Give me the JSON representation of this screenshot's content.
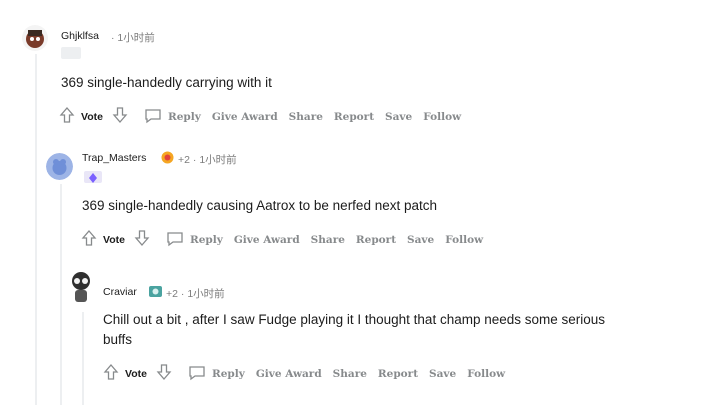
{
  "comments": [
    {
      "username": "Ghjklfsa",
      "meta": "· 1小时前",
      "awards_count": "",
      "body": "369 single-handedly carrying with it",
      "actions": {
        "vote": "Vote",
        "reply": "Reply",
        "give_award": "Give Award",
        "share": "Share",
        "report": "Report",
        "save": "Save",
        "follow": "Follow"
      }
    },
    {
      "username": "Trap_Masters",
      "meta": "· 1小时前",
      "awards_count": "+2",
      "body": "369 single-handedly causing Aatrox to be nerfed next patch",
      "actions": {
        "vote": "Vote",
        "reply": "Reply",
        "give_award": "Give Award",
        "share": "Share",
        "report": "Report",
        "save": "Save",
        "follow": "Follow"
      }
    },
    {
      "username": "Craviar",
      "meta": "· 1小时前",
      "awards_count": "+2",
      "body_line1": "Chill out a bit , after I saw Fudge playing it I thought that champ needs some serious",
      "body_line2": "buffs",
      "actions": {
        "vote": "Vote",
        "reply": "Reply",
        "give_award": "Give Award",
        "share": "Share",
        "report": "Report",
        "save": "Save",
        "follow": "Follow"
      }
    }
  ],
  "colors": {
    "muted": "#878a8c",
    "thread": "#edeff1",
    "text": "#1c1c1c"
  },
  "icons": [
    "upvote-arrow-icon",
    "downvote-arrow-icon",
    "reply-bubble-icon",
    "award-icon"
  ]
}
